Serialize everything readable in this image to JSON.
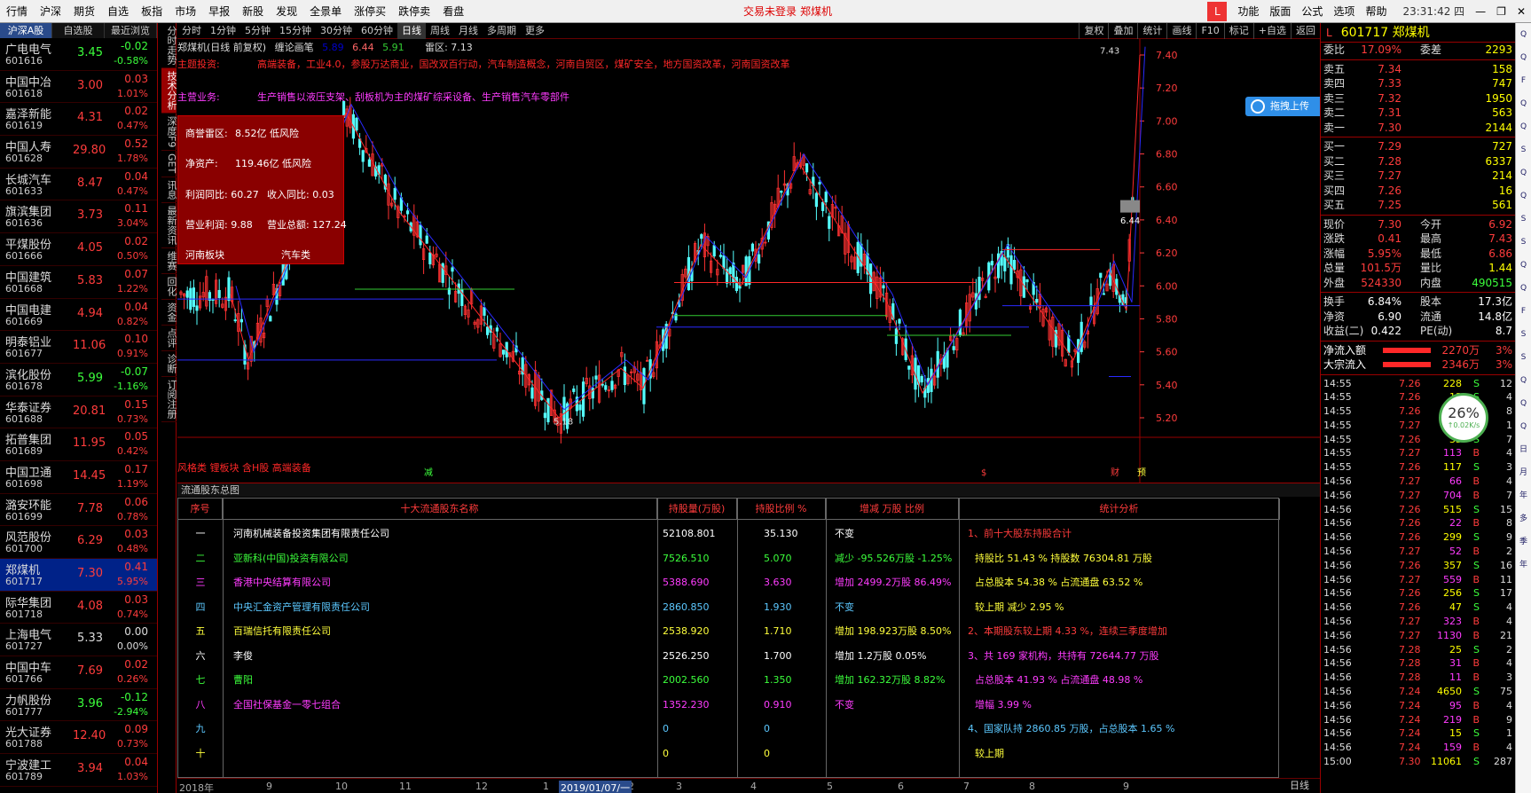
{
  "menu": {
    "items": [
      "行情",
      "沪深",
      "期货",
      "自选",
      "板指",
      "市场",
      "早报",
      "新股",
      "发现",
      "全景单",
      "涨停买",
      "跌停卖",
      "看盘"
    ],
    "status": "交易未登录",
    "stock": "郑煤机",
    "right": [
      "功能",
      "版面",
      "公式",
      "选项",
      "帮助"
    ],
    "time": "23:31:42 四",
    "logo": "L"
  },
  "left": {
    "tabs": [
      "沪深A股",
      "自选股",
      "最近浏览"
    ],
    "rows": [
      {
        "name": "广电电气",
        "code": "601616",
        "price": "3.45",
        "chg": "-0.02",
        "pct": "-0.58%",
        "dir": "dn"
      },
      {
        "name": "中国中冶",
        "code": "601618",
        "price": "3.00",
        "chg": "0.03",
        "pct": "1.01%",
        "dir": "up"
      },
      {
        "name": "嘉泽新能",
        "code": "601619",
        "price": "4.31",
        "chg": "0.02",
        "pct": "0.47%",
        "dir": "up"
      },
      {
        "name": "中国人寿",
        "code": "601628",
        "price": "29.80",
        "chg": "0.52",
        "pct": "1.78%",
        "dir": "up"
      },
      {
        "name": "长城汽车",
        "code": "601633",
        "price": "8.47",
        "chg": "0.04",
        "pct": "0.47%",
        "dir": "up"
      },
      {
        "name": "旗滨集团",
        "code": "601636",
        "price": "3.73",
        "chg": "0.11",
        "pct": "3.04%",
        "dir": "up"
      },
      {
        "name": "平煤股份",
        "code": "601666",
        "price": "4.05",
        "chg": "0.02",
        "pct": "0.50%",
        "dir": "up"
      },
      {
        "name": "中国建筑",
        "code": "601668",
        "price": "5.83",
        "chg": "0.07",
        "pct": "1.22%",
        "dir": "up"
      },
      {
        "name": "中国电建",
        "code": "601669",
        "price": "4.94",
        "chg": "0.04",
        "pct": "0.82%",
        "dir": "up"
      },
      {
        "name": "明泰铝业",
        "code": "601677",
        "price": "11.06",
        "chg": "0.10",
        "pct": "0.91%",
        "dir": "up"
      },
      {
        "name": "滨化股份",
        "code": "601678",
        "price": "5.99",
        "chg": "-0.07",
        "pct": "-1.16%",
        "dir": "dn"
      },
      {
        "name": "华泰证券",
        "code": "601688",
        "price": "20.81",
        "chg": "0.15",
        "pct": "0.73%",
        "dir": "up"
      },
      {
        "name": "拓普集团",
        "code": "601689",
        "price": "11.95",
        "chg": "0.05",
        "pct": "0.42%",
        "dir": "up"
      },
      {
        "name": "中国卫通",
        "code": "601698",
        "price": "14.45",
        "chg": "0.17",
        "pct": "1.19%",
        "dir": "up"
      },
      {
        "name": "潞安环能",
        "code": "601699",
        "price": "7.78",
        "chg": "0.06",
        "pct": "0.78%",
        "dir": "up"
      },
      {
        "name": "风范股份",
        "code": "601700",
        "price": "6.29",
        "chg": "0.03",
        "pct": "0.48%",
        "dir": "up"
      },
      {
        "name": "郑煤机",
        "code": "601717",
        "price": "7.30",
        "chg": "0.41",
        "pct": "5.95%",
        "dir": "up",
        "sel": true
      },
      {
        "name": "际华集团",
        "code": "601718",
        "price": "4.08",
        "chg": "0.03",
        "pct": "0.74%",
        "dir": "up"
      },
      {
        "name": "上海电气",
        "code": "601727",
        "price": "5.33",
        "chg": "0.00",
        "pct": "0.00%",
        "dir": "fl"
      },
      {
        "name": "中国中车",
        "code": "601766",
        "price": "7.69",
        "chg": "0.02",
        "pct": "0.26%",
        "dir": "up"
      },
      {
        "name": "力帆股份",
        "code": "601777",
        "price": "3.96",
        "chg": "-0.12",
        "pct": "-2.94%",
        "dir": "dn"
      },
      {
        "name": "光大证券",
        "code": "601788",
        "price": "12.40",
        "chg": "0.09",
        "pct": "0.73%",
        "dir": "up"
      },
      {
        "name": "宁波建工",
        "code": "601789",
        "price": "3.94",
        "chg": "0.04",
        "pct": "1.03%",
        "dir": "up"
      }
    ]
  },
  "vtabs": [
    "分时走势",
    "技术分析",
    "深度F9",
    "GET",
    "讯息",
    "最新资讯",
    "维赛",
    "回化",
    "资金",
    "点评",
    "诊断",
    "订阅注册"
  ],
  "toolbar": {
    "left": [
      "分时",
      "1分钟",
      "5分钟",
      "15分钟",
      "30分钟",
      "60分钟",
      "日线",
      "周线",
      "月线",
      "多周期",
      "更多"
    ],
    "active": "日线",
    "right": [
      "复权",
      "叠加",
      "统计",
      "画线",
      "F10",
      "标记",
      "+自选",
      "返回"
    ]
  },
  "chart": {
    "title": "郑煤机(日线 前复权)",
    "indicator": "缠论画笔",
    "v1": "5.89",
    "v2": "6.44",
    "v3": "5.91",
    "leiqu": "雷区: 7.13",
    "topic_label": "主题投资:",
    "topic": "高端装备，工业4.0，参股万达商业，国改双百行动，汽车制造概念，河南自贸区，煤矿安全，地方国资改革，河南国资改革",
    "biz_label": "主营业务:",
    "biz": "生产销售以液压支架、刮板机为主的煤矿综采设备、生产销售汽车零部件",
    "high_label": "7.43",
    "low_label": "5.18",
    "last_label": "6.44",
    "bottom_left": "风格类   锂板块 含H股 高端装备",
    "marks": [
      "减",
      "$",
      "财",
      "预"
    ],
    "price_axis": [
      "7.40",
      "7.20",
      "7.00",
      "6.80",
      "6.60",
      "6.40",
      "6.20",
      "6.00",
      "5.80",
      "5.60",
      "5.40",
      "5.20"
    ]
  },
  "popup": {
    "l1": "商誉雷区:",
    "v1": "8.52亿 低风险",
    "l2": "净资产:",
    "v2": "119.46亿 低风险",
    "l3": "利润同比: 60.27",
    "l3b": "收入同比: 0.03",
    "l4": "营业利润: 9.88",
    "l4b": "营业总额: 127.24",
    "l5": "河南板块",
    "l5b": "汽车类"
  },
  "upload": "拖拽上传",
  "table": {
    "bar": "流通股东总图",
    "headers": [
      "序号",
      "十大流通股东名称",
      "持股量(万股)",
      "持股比例 %",
      "增减 万股 比例",
      "统计分析"
    ],
    "rows": [
      {
        "no": "一",
        "name": "河南机械装备投资集团有限责任公司",
        "qty": "52108.801",
        "ratio": "35.130",
        "chg": "不变",
        "color": "#ffffff"
      },
      {
        "no": "二",
        "name": "亚新科(中国)投资有限公司",
        "qty": "7526.510",
        "ratio": "5.070",
        "chg": "减少 -95.526万股 -1.25%",
        "color": "#3cff3c"
      },
      {
        "no": "三",
        "name": "香港中央结算有限公司",
        "qty": "5388.690",
        "ratio": "3.630",
        "chg": "增加 2499.2万股 86.49%",
        "color": "#ff3cff"
      },
      {
        "no": "四",
        "name": "中央汇金资产管理有限责任公司",
        "qty": "2860.850",
        "ratio": "1.930",
        "chg": "不变",
        "color": "#5cc8ff"
      },
      {
        "no": "五",
        "name": "百瑞信托有限责任公司",
        "qty": "2538.920",
        "ratio": "1.710",
        "chg": "增加 198.923万股 8.50%",
        "color": "#ffff3c"
      },
      {
        "no": "六",
        "name": "李俊",
        "qty": "2526.250",
        "ratio": "1.700",
        "chg": "增加 1.2万股 0.05%",
        "color": "#ffffff"
      },
      {
        "no": "七",
        "name": "曹阳",
        "qty": "2002.560",
        "ratio": "1.350",
        "chg": "增加 162.32万股 8.82%",
        "color": "#3cff3c"
      },
      {
        "no": "八",
        "name": "全国社保基金一零七组合",
        "qty": "1352.230",
        "ratio": "0.910",
        "chg": "不变",
        "color": "#ff3cff"
      },
      {
        "no": "九",
        "name": "",
        "qty": "0",
        "ratio": "0",
        "chg": "",
        "color": "#5cc8ff"
      },
      {
        "no": "十",
        "name": "",
        "qty": "0",
        "ratio": "0",
        "chg": "",
        "color": "#ffff3c"
      }
    ],
    "stats": [
      {
        "t": "1、前十大股东持股合计",
        "c": "#ff3c3c"
      },
      {
        "t": "持股比 51.43 %    持股数 76304.81 万股",
        "c": "#ffff3c"
      },
      {
        "t": "占总股本 54.38 %    占流通盘 63.52 %",
        "c": "#ffff3c"
      },
      {
        "t": "较上期  减少  2.95  %",
        "c": "#ffff3c"
      },
      {
        "t": "2、本期股东较上期 4.33 %，连续三季度增加",
        "c": "#ff3c3c"
      },
      {
        "t": "3、共 169 家机构，共持有 72644.77 万股",
        "c": "#ff3cff"
      },
      {
        "t": "占总股本 41.93 %    占流通盘 48.98 %",
        "c": "#ff3cff"
      },
      {
        "t": "增幅 3.99 %",
        "c": "#ff3cff"
      },
      {
        "t": "4、国家队持 2860.85 万股，占总股本 1.65 %",
        "c": "#5cc8ff"
      },
      {
        "t": "较上期",
        "c": "#ffff3c"
      }
    ]
  },
  "dates": {
    "y": "2018年",
    "ticks": [
      "9",
      "10",
      "11",
      "12",
      "1",
      "2",
      "3",
      "4",
      "5",
      "6",
      "7",
      "8",
      "9"
    ],
    "selected": "2019/01/07/一",
    "line": "日线"
  },
  "right": {
    "code": "601717",
    "name": "郑煤机",
    "mark": "L",
    "weibi_label": "委比",
    "weibi": "17.09%",
    "weicha_label": "委差",
    "weicha": "2293",
    "sells": [
      {
        "l": "卖五",
        "p": "7.34",
        "v": "158"
      },
      {
        "l": "卖四",
        "p": "7.33",
        "v": "747"
      },
      {
        "l": "卖三",
        "p": "7.32",
        "v": "1950"
      },
      {
        "l": "卖二",
        "p": "7.31",
        "v": "563"
      },
      {
        "l": "卖一",
        "p": "7.30",
        "v": "2144"
      }
    ],
    "buys": [
      {
        "l": "买一",
        "p": "7.29",
        "v": "727"
      },
      {
        "l": "买二",
        "p": "7.28",
        "v": "6337"
      },
      {
        "l": "买三",
        "p": "7.27",
        "v": "214"
      },
      {
        "l": "买四",
        "p": "7.26",
        "v": "16"
      },
      {
        "l": "买五",
        "p": "7.25",
        "v": "561"
      }
    ],
    "quote": [
      [
        "现价",
        "7.30",
        "今开",
        "6.92"
      ],
      [
        "涨跌",
        "0.41",
        "最高",
        "7.43"
      ],
      [
        "涨幅",
        "5.95%",
        "最低",
        "6.86"
      ],
      [
        "总量",
        "101.5万",
        "量比",
        "1.44"
      ],
      [
        "外盘",
        "524330",
        "内盘",
        "490515"
      ]
    ],
    "quote2": [
      [
        "换手",
        "6.84%",
        "股本",
        "17.3亿"
      ],
      [
        "净资",
        "6.90",
        "流通",
        "14.8亿"
      ],
      [
        "收益(二)",
        "0.422",
        "PE(动)",
        "8.7"
      ]
    ],
    "flows": [
      {
        "l": "净流入额",
        "v": "2270万",
        "p": "3%"
      },
      {
        "l": "大宗流入",
        "v": "2346万",
        "p": "3%"
      }
    ],
    "ticks": [
      [
        "14:55",
        "7.26",
        "228",
        "S",
        "12"
      ],
      [
        "14:55",
        "7.26",
        "13",
        "S",
        "4"
      ],
      [
        "14:55",
        "7.26",
        "36",
        "S",
        "8"
      ],
      [
        "14:55",
        "7.27",
        "1",
        "B",
        "1"
      ],
      [
        "14:55",
        "7.26",
        "33",
        "S",
        "7"
      ],
      [
        "14:55",
        "7.27",
        "113",
        "B",
        "4"
      ],
      [
        "14:55",
        "7.26",
        "117",
        "S",
        "3"
      ],
      [
        "14:56",
        "7.27",
        "66",
        "B",
        "4"
      ],
      [
        "14:56",
        "7.27",
        "704",
        "B",
        "7"
      ],
      [
        "14:56",
        "7.26",
        "515",
        "S",
        "15"
      ],
      [
        "14:56",
        "7.26",
        "22",
        "B",
        "8"
      ],
      [
        "14:56",
        "7.26",
        "299",
        "S",
        "9"
      ],
      [
        "14:56",
        "7.27",
        "52",
        "B",
        "2"
      ],
      [
        "14:56",
        "7.26",
        "357",
        "S",
        "16"
      ],
      [
        "14:56",
        "7.27",
        "559",
        "B",
        "11"
      ],
      [
        "14:56",
        "7.26",
        "256",
        "S",
        "17"
      ],
      [
        "14:56",
        "7.26",
        "47",
        "S",
        "4"
      ],
      [
        "14:56",
        "7.27",
        "323",
        "B",
        "4"
      ],
      [
        "14:56",
        "7.27",
        "1130",
        "B",
        "21"
      ],
      [
        "14:56",
        "7.28",
        "25",
        "S",
        "2"
      ],
      [
        "14:56",
        "7.28",
        "31",
        "B",
        "4"
      ],
      [
        "14:56",
        "7.28",
        "11",
        "B",
        "3"
      ],
      [
        "14:56",
        "7.24",
        "4650",
        "S",
        "75"
      ],
      [
        "14:56",
        "7.24",
        "95",
        "B",
        "4"
      ],
      [
        "14:56",
        "7.24",
        "219",
        "B",
        "9"
      ],
      [
        "14:56",
        "7.24",
        "15",
        "S",
        "1"
      ],
      [
        "14:56",
        "7.24",
        "159",
        "B",
        "4"
      ],
      [
        "15:00",
        "7.30",
        "11061",
        "S",
        "287"
      ]
    ],
    "speed": "26%",
    "speed_sub": "↑0.02K/s"
  },
  "rightstrip": [
    "Q",
    "Q",
    "F",
    "Q",
    "Q",
    "S",
    "Q",
    "Q",
    "S",
    "S",
    "Q",
    "Q",
    "F",
    "S",
    "S",
    "Q",
    "Q",
    "Q",
    "日",
    "月",
    "年",
    "多",
    "季",
    "年"
  ],
  "colors": {
    "up": "#ff3c3c",
    "down": "#3cff3c",
    "accent": "#900000"
  }
}
